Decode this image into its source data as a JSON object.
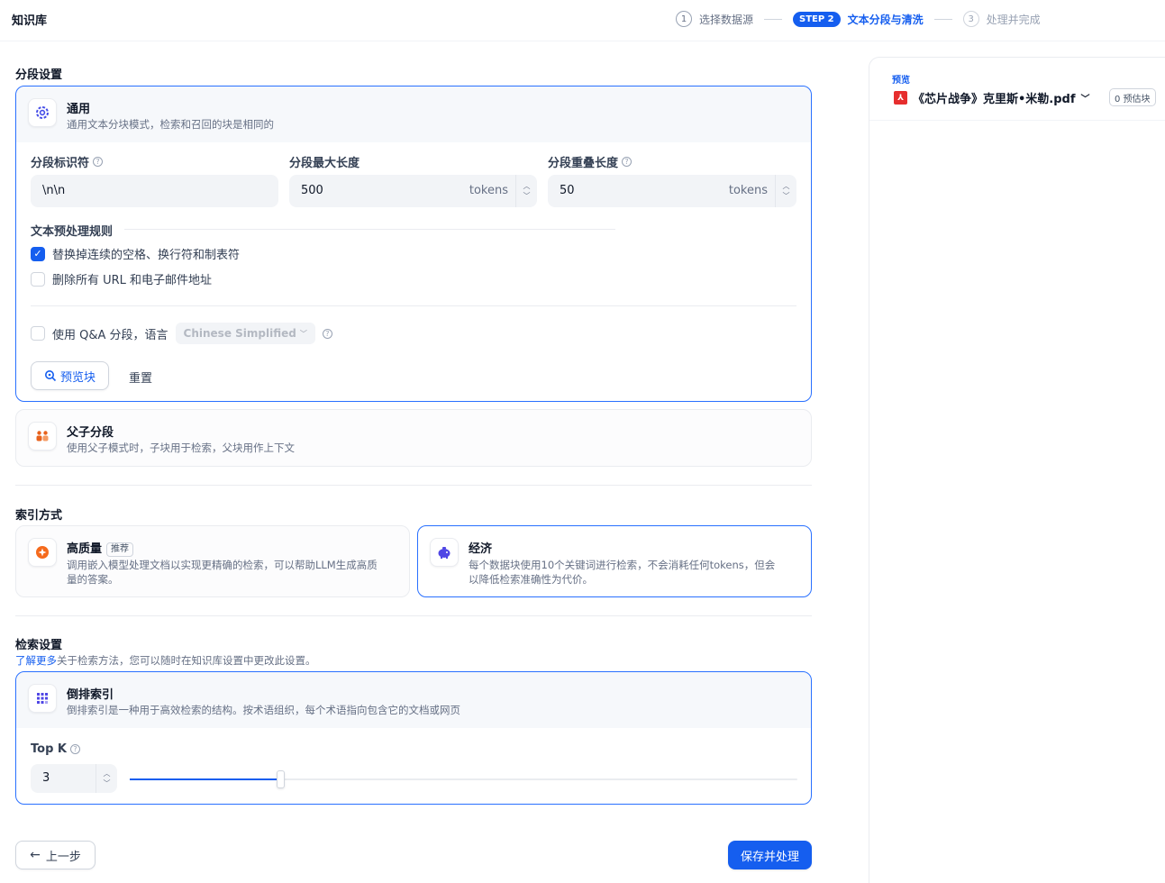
{
  "app": {
    "title": "知识库"
  },
  "steps": [
    {
      "num": "1",
      "label": "选择数据源",
      "state": "done"
    },
    {
      "num": "STEP 2",
      "label": "文本分段与清洗",
      "state": "active"
    },
    {
      "num": "3",
      "label": "处理并完成",
      "state": "pending"
    }
  ],
  "segmentation": {
    "section_title": "分段设置",
    "general": {
      "title": "通用",
      "desc": "通用文本分块模式，检索和召回的块是相同的",
      "identifier": {
        "label": "分段标识符",
        "value": "\\n\\n"
      },
      "max_length": {
        "label": "分段最大长度",
        "value": "500",
        "unit": "tokens"
      },
      "overlap": {
        "label": "分段重叠长度",
        "value": "50",
        "unit": "tokens"
      },
      "rules_title": "文本预处理规则",
      "rule_replace": {
        "label": "替换掉连续的空格、换行符和制表符",
        "checked": true
      },
      "rule_remove_urls": {
        "label": "删除所有 URL 和电子邮件地址",
        "checked": false
      },
      "qa": {
        "label": "使用 Q&A 分段，语言",
        "language": "Chinese Simplified",
        "checked": false
      },
      "preview_button": "预览块",
      "reset_button": "重置"
    },
    "parent_child": {
      "title": "父子分段",
      "desc": "使用父子模式时，子块用于检索，父块用作上下文"
    }
  },
  "index": {
    "section_title": "索引方式",
    "high_quality": {
      "title": "高质量",
      "badge": "推荐",
      "desc_line1": "调用嵌入模型处理文档以实现更精确的检索，可以帮助LLM生成高质",
      "desc_line2": "量的答案。"
    },
    "economy": {
      "title": "经济",
      "desc_line1": "每个数据块使用10个关键词进行检索，不会消耗任何tokens，但会",
      "desc_line2": "以降低检索准确性为代价。"
    }
  },
  "retrieval": {
    "section_title": "检索设置",
    "learn_more": "了解更多",
    "hint": "关于检索方法，您可以随时在知识库设置中更改此设置。",
    "inverted": {
      "title": "倒排索引",
      "desc": "倒排索引是一种用于高效检索的结构。按术语组织，每个术语指向包含它的文档或网页"
    },
    "top_k": {
      "label": "Top K",
      "value": "3",
      "slider_fraction": 0.225
    }
  },
  "footer": {
    "back_button": "上一步",
    "save_button": "保存并处理"
  },
  "preview": {
    "label": "预览",
    "file_name": "《芯片战争》克里斯•米勒.pdf",
    "estimate": "0 预估块"
  },
  "colors": {
    "accent": "#155eef",
    "border_active": "#2970ff"
  }
}
